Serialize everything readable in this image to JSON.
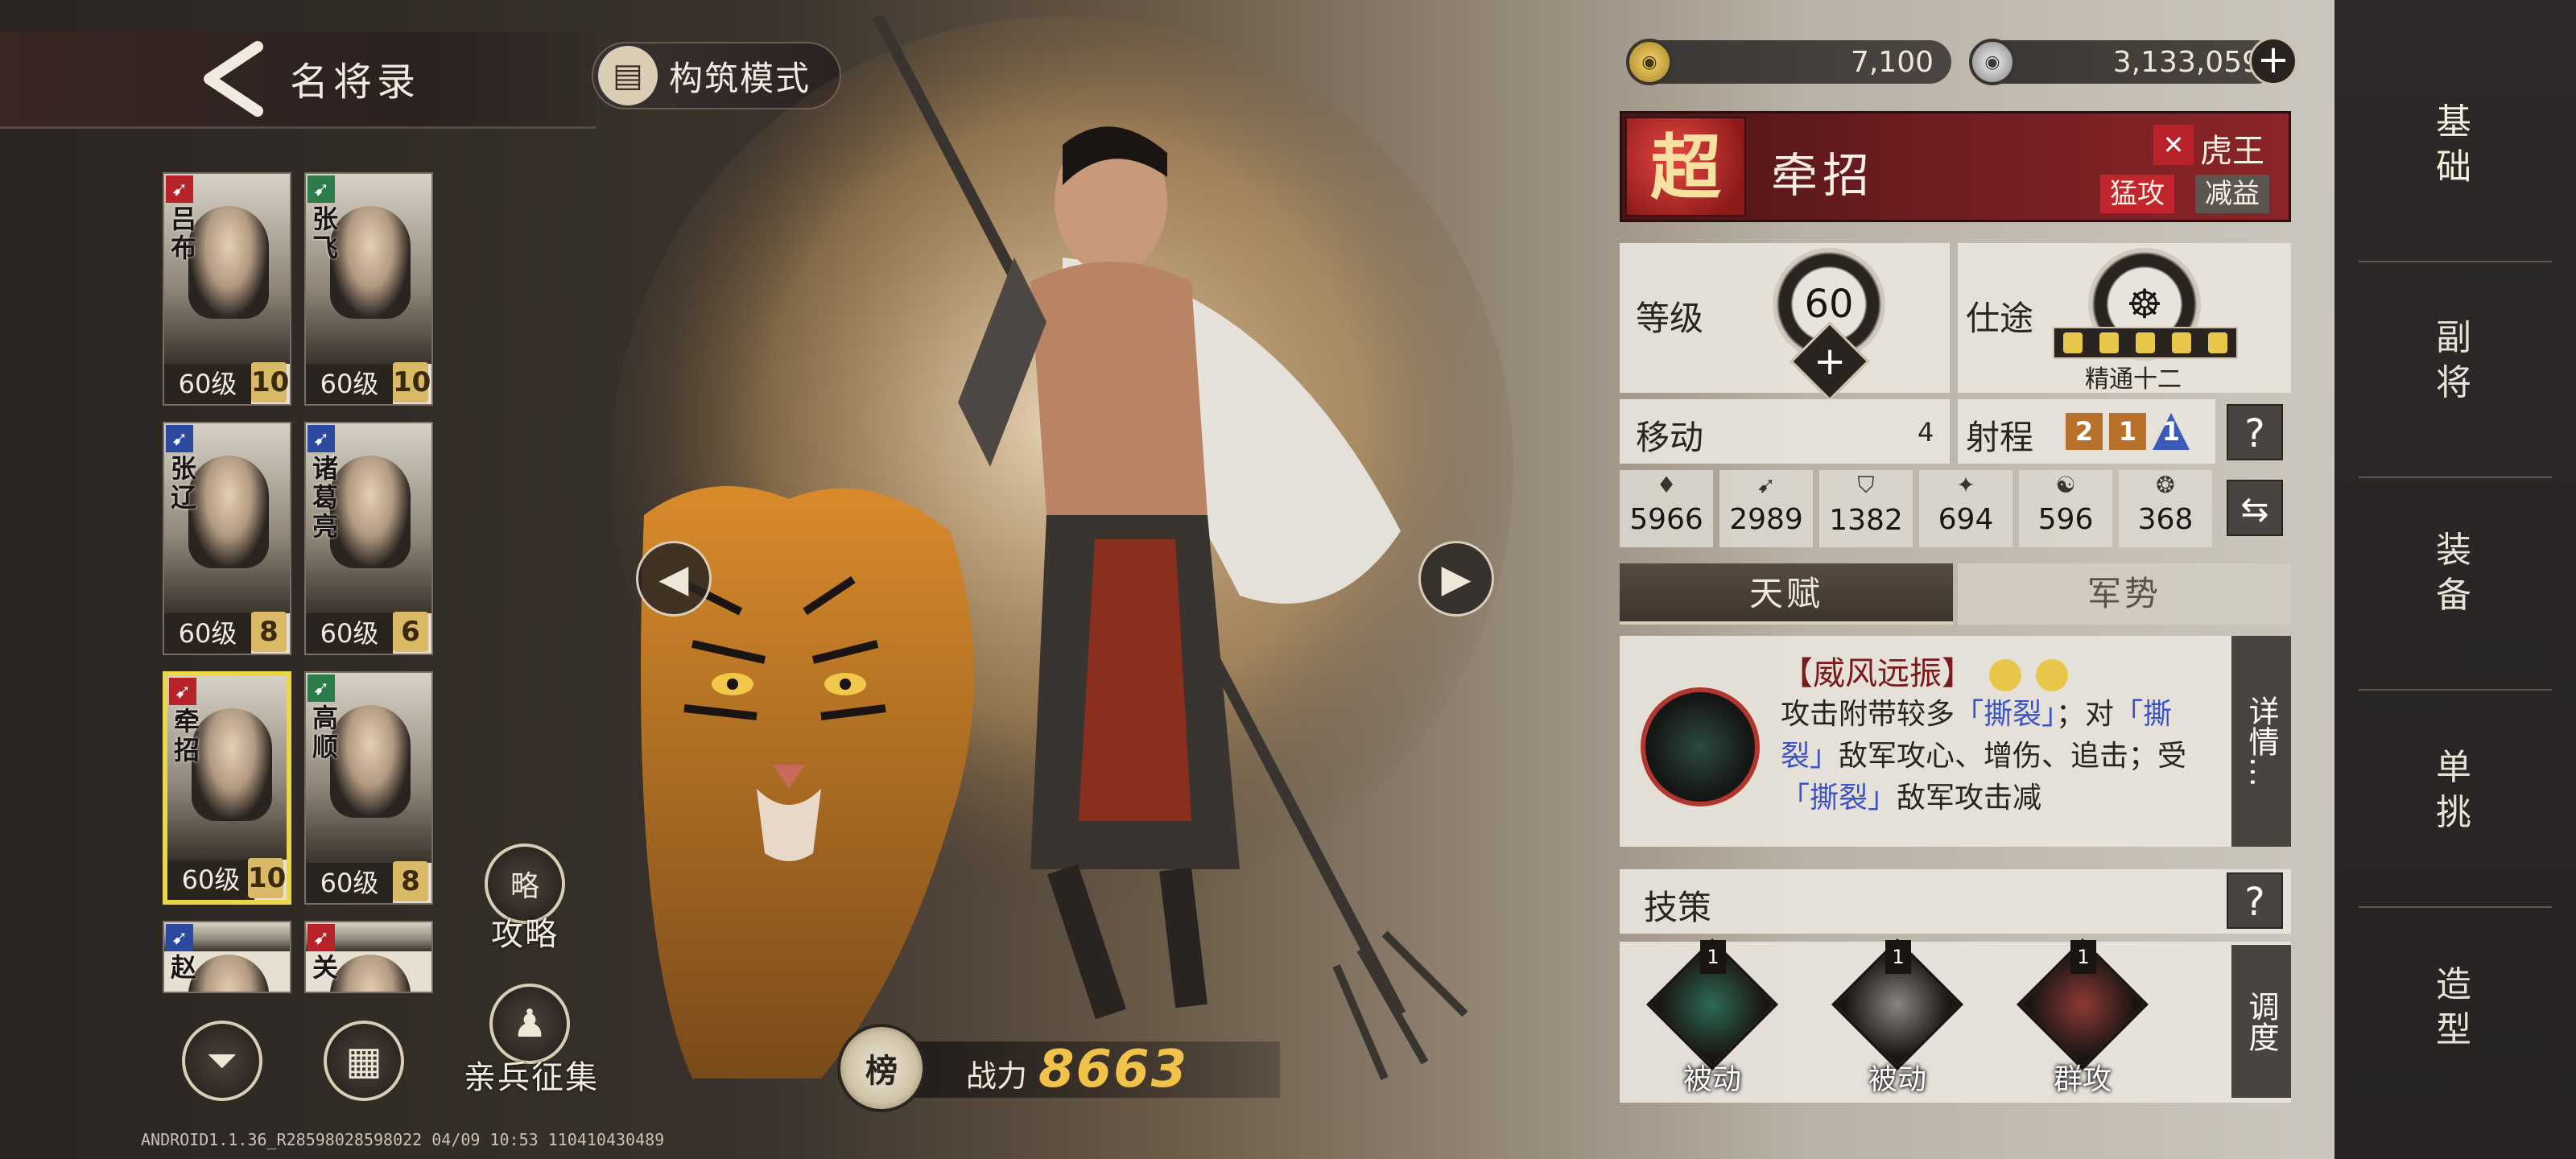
{
  "header": {
    "title": "名将录",
    "build_mode_label": "构筑模式"
  },
  "heroes": [
    {
      "name": "吕布",
      "class_icon": "cavalry-icon",
      "level": "60级",
      "rank": "10",
      "color": "#b8232a"
    },
    {
      "name": "张飞",
      "class_icon": "spear-icon",
      "level": "60级",
      "rank": "10",
      "color": "#2d7d4b"
    },
    {
      "name": "张辽",
      "class_icon": "cavalry-icon",
      "level": "60级",
      "rank": "8",
      "color": "#2b4aa0"
    },
    {
      "name": "诸葛亮",
      "class_icon": "strategist-icon",
      "level": "60级",
      "rank": "6",
      "color": "#2b4aa0"
    },
    {
      "name": "牵招",
      "class_icon": "spear-icon",
      "level": "60级",
      "rank": "10",
      "color": "#b8232a"
    },
    {
      "name": "高顺",
      "class_icon": "cavalry-icon",
      "level": "60级",
      "rank": "8",
      "color": "#2d7d4b"
    },
    {
      "name": "赵",
      "class_icon": "cavalry-icon",
      "level": "",
      "rank": "",
      "color": "#2b4aa0"
    },
    {
      "name": "关",
      "class_icon": "cavalry-icon",
      "level": "",
      "rank": "",
      "color": "#b8232a"
    }
  ],
  "sidebar_buttons": {
    "strategy_icon_text": "略",
    "strategy_label": "攻略",
    "recruit_label": "亲兵征集"
  },
  "build_info": "ANDROID1.1.36_R28598028598022 04/09 10:53 110410430489",
  "power": {
    "label": "战力",
    "value": "8663",
    "medal_text": "榜"
  },
  "currency": {
    "gold": "7,100",
    "silver": "3,133,059"
  },
  "hero": {
    "rarity": "超",
    "name": "牵招",
    "tag_name": "虎王",
    "tag_attack": "猛攻",
    "tag_debuff": "减益",
    "level_label": "等级",
    "level": "60",
    "career_label": "仕途",
    "career_text": "精通十二",
    "move_label": "移动",
    "move": "4",
    "range_label": "射程",
    "range": [
      "2",
      "1",
      "1"
    ],
    "help": "?",
    "attrs": [
      {
        "icon": "force-icon",
        "glyph": "♦",
        "value": "5966"
      },
      {
        "icon": "attack-icon",
        "glyph": "➹",
        "value": "2989"
      },
      {
        "icon": "defense-icon",
        "glyph": "⛉",
        "value": "1382"
      },
      {
        "icon": "intellect-icon",
        "glyph": "✦",
        "value": "694"
      },
      {
        "icon": "spirit-icon",
        "glyph": "☯",
        "value": "596"
      },
      {
        "icon": "speed-icon",
        "glyph": "❂",
        "value": "368"
      }
    ]
  },
  "tabs": {
    "talent": "天赋",
    "momentum": "军势"
  },
  "talent": {
    "title": "【威风远振】",
    "desc_1": "攻击附带较多",
    "kw_1": "「撕裂」",
    "desc_2": "；对",
    "kw_2": "「撕裂」",
    "desc_3": "敌军攻心、增伤、追击；受",
    "kw_3": "「撕裂」",
    "desc_4": "敌军攻击减",
    "detail_label": "详情…"
  },
  "skills": {
    "section_label": "技策",
    "adjust_label": "调度",
    "items": [
      {
        "label": "被动",
        "level": "1",
        "color": "#2e6a55"
      },
      {
        "label": "被动",
        "level": "1",
        "color": "#8a8580"
      },
      {
        "label": "群攻",
        "level": "1",
        "color": "#8e3a36"
      }
    ]
  },
  "right_nav": [
    "基础",
    "副将",
    "装备",
    "单挑",
    "造型"
  ]
}
